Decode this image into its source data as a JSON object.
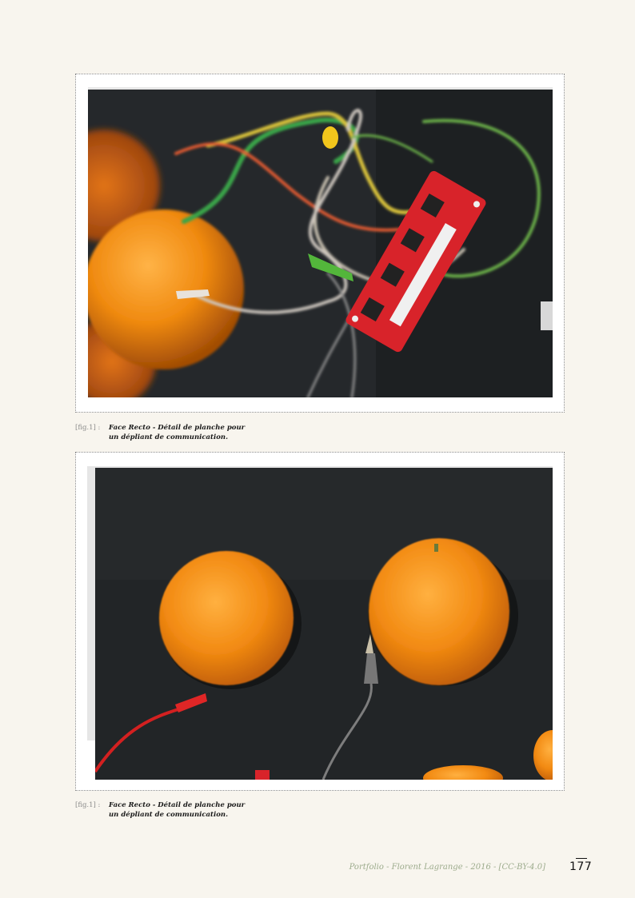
{
  "figures": [
    {
      "ref": "[fig.1] :",
      "caption_line1": "Face Recto - Détail de planche pour",
      "caption_line2": "un dépliant de communication."
    },
    {
      "ref": "[fig.1] :",
      "caption_line1": "Face Recto - Détail de planche pour",
      "caption_line2": "un dépliant de communication."
    }
  ],
  "footer": {
    "credit": "Portfolio - Florent Lagrange - 2016 - [CC-BY-4.0]",
    "page_number": "177"
  },
  "colors": {
    "page_background": "#f8f5ee",
    "photo_background": "#1f2224",
    "orange": "#f08a10",
    "board_red": "#d8232a",
    "footer_text": "#9cab8c"
  }
}
